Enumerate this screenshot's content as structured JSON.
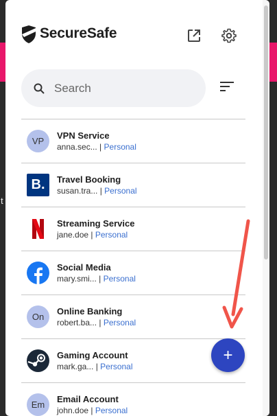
{
  "app": {
    "brand": "SecureSafe"
  },
  "header": {
    "open_icon": "external-link-icon",
    "settings_icon": "gear-icon"
  },
  "search": {
    "placeholder": "Search",
    "icon": "search-icon"
  },
  "sort": {
    "icon": "sort-icon"
  },
  "items": [
    {
      "title": "VPN Service",
      "user": "anna.sec...",
      "tag": "Personal",
      "avatar": "VP"
    },
    {
      "title": "Travel Booking",
      "user": "susan.tra...",
      "tag": "Personal",
      "avatar": "B."
    },
    {
      "title": "Streaming Service",
      "user": "jane.doe",
      "tag": "Personal",
      "avatar": "N"
    },
    {
      "title": "Social Media",
      "user": "mary.smi...",
      "tag": "Personal",
      "avatar": "f"
    },
    {
      "title": "Online Banking",
      "user": "robert.ba...",
      "tag": "Personal",
      "avatar": "On"
    },
    {
      "title": "Gaming Account",
      "user": "mark.ga...",
      "tag": "Personal",
      "avatar": "steam"
    },
    {
      "title": "Email Account",
      "user": "john.doe",
      "tag": "Personal",
      "avatar": "Em"
    }
  ],
  "fab": {
    "label": "+"
  },
  "colors": {
    "accent": "#2d45c0",
    "tag": "#3a6fcf",
    "annotation": "#f0554a",
    "netflix": "#e50914",
    "facebook": "#1877f2",
    "booking": "#003580"
  }
}
